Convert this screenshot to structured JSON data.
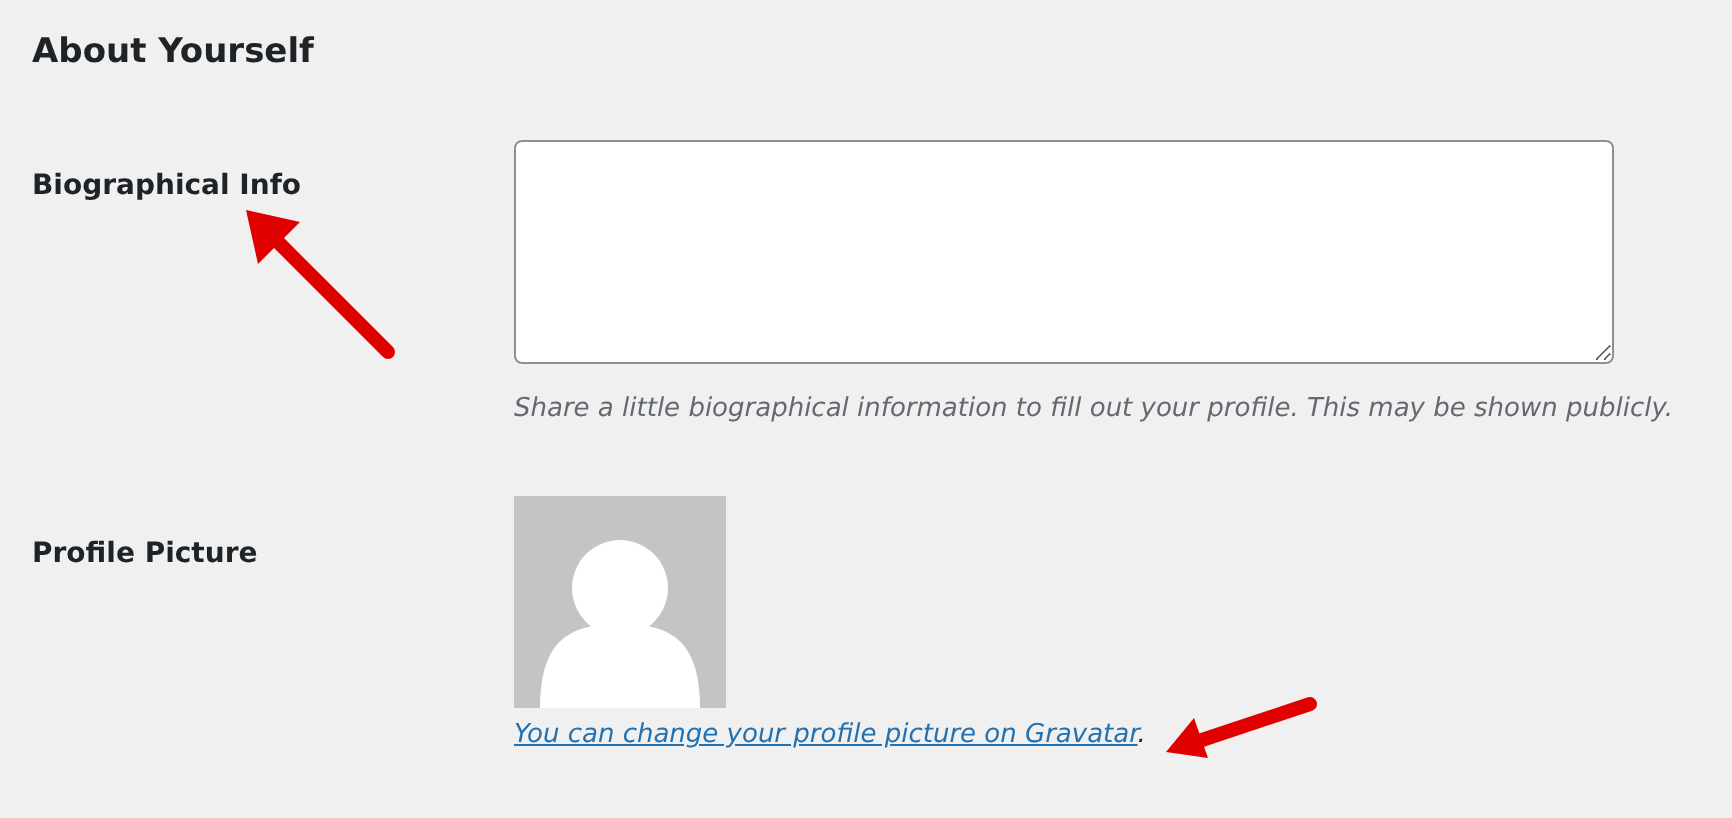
{
  "section_title": "About Yourself",
  "rows": [
    {
      "kind": "textarea",
      "label": "Biographical Info",
      "description": "Share a little biographical information to fill out your profile. This may be shown publicly."
    },
    {
      "kind": "avatar",
      "label": "Profile Picture",
      "link": "You can change your profile picture on Gravatar",
      "suffix": "."
    }
  ]
}
